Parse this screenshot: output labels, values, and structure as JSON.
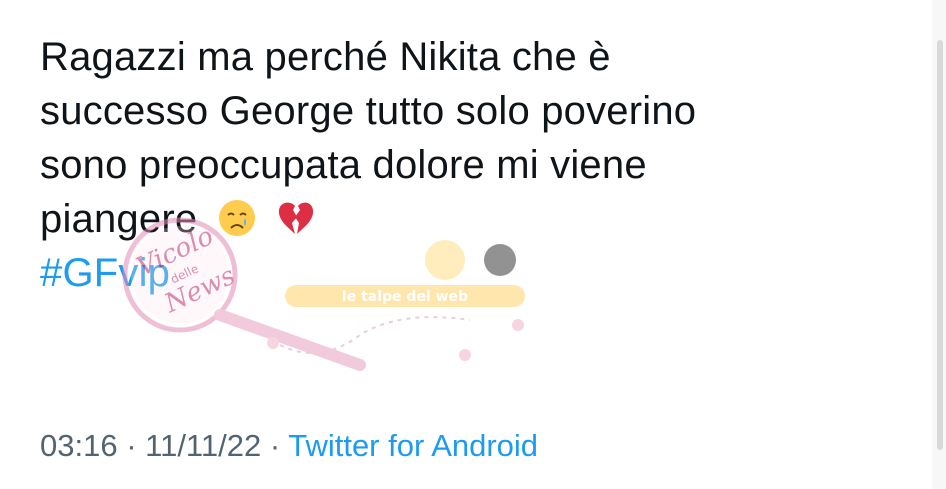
{
  "tweet": {
    "lines": [
      "Ragazzi ma perché Nikita che è",
      "successo George tutto solo poverino",
      "sono preoccupata dolore mi viene",
      "piangere"
    ],
    "emojis": [
      "crying-face-icon",
      "broken-heart-icon"
    ],
    "hashtag": "#GFvip"
  },
  "meta": {
    "time": "03:16",
    "separator1": " · ",
    "date": "11/11/22",
    "separator2": " · ",
    "source": "Twitter for Android"
  },
  "watermark": {
    "magnifier_text": "Vicolo delle News",
    "banner_text": "le talpe del web"
  },
  "colors": {
    "text": "#0f1419",
    "link": "#1d9bf0",
    "meta": "#536471",
    "background": "#ffffff"
  }
}
